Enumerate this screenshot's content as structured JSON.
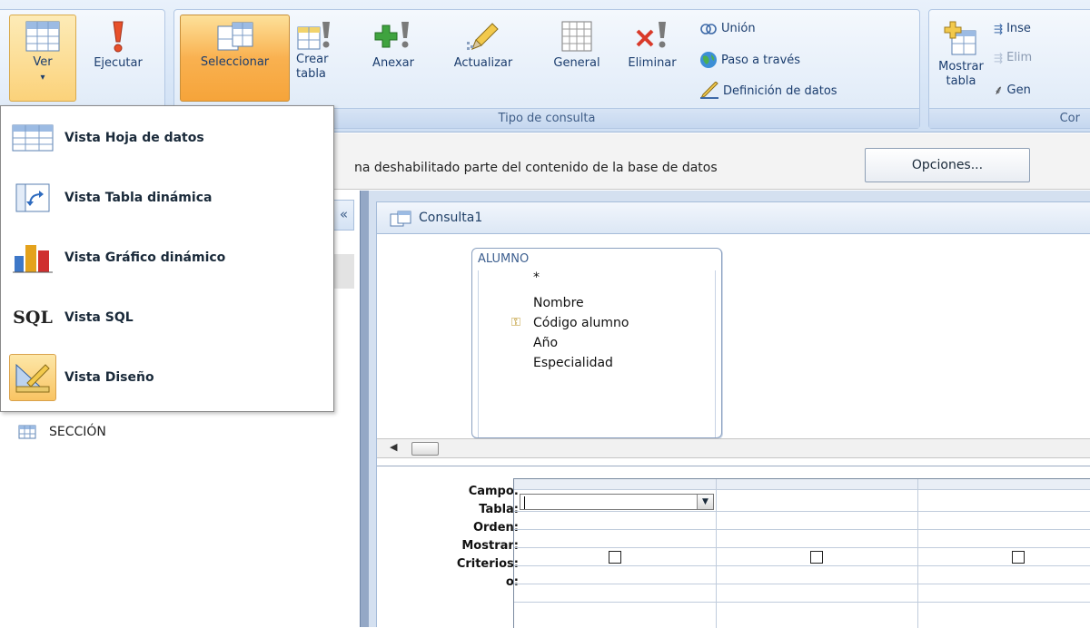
{
  "ribbon": {
    "groups": {
      "results_label": "",
      "query_type_label": "Tipo de consulta",
      "config_label": "Cor"
    },
    "buttons": {
      "ver": "Ver",
      "ver_arrow": "▾",
      "ejecutar": "Ejecutar",
      "seleccionar": "Seleccionar",
      "crear_tabla_1": "Crear",
      "crear_tabla_2": "tabla",
      "anexar": "Anexar",
      "actualizar": "Actualizar",
      "general": "General",
      "eliminar": "Eliminar",
      "union": "Unión",
      "paso_traves": "Paso a través",
      "definicion": "Definición de datos",
      "mostrar_tabla_1": "Mostrar",
      "mostrar_tabla_2": "tabla",
      "insertar": "Inse",
      "eliminar2": "Elim",
      "generador": "Gen"
    }
  },
  "messagebar": {
    "text": "na deshabilitado parte del contenido de la base de datos",
    "options_button": "Opciones..."
  },
  "nav": {
    "collapse": "«",
    "item_seccion": "SECCIÓN"
  },
  "view_menu": {
    "items": [
      {
        "label": "Vista Hoja de datos",
        "icon": "datasheet-icon"
      },
      {
        "label": "Vista Tabla dinámica",
        "icon": "pivottable-icon"
      },
      {
        "label": "Vista Gráfico dinámico",
        "icon": "pivotchart-icon"
      },
      {
        "label": "Vista SQL",
        "icon": "sql-icon"
      },
      {
        "label": "Vista Diseño",
        "icon": "design-icon"
      }
    ],
    "sql_icon_text": "SQL"
  },
  "document": {
    "tab_title": "Consulta1",
    "table_name": "ALUMNO",
    "fields": [
      "*",
      "Nombre",
      "Código alumno",
      "Año",
      "Especialidad"
    ],
    "grid_labels": [
      "Campo:",
      "Tabla:",
      "Orden:",
      "Mostrar:",
      "Criterios:",
      "o:"
    ]
  }
}
